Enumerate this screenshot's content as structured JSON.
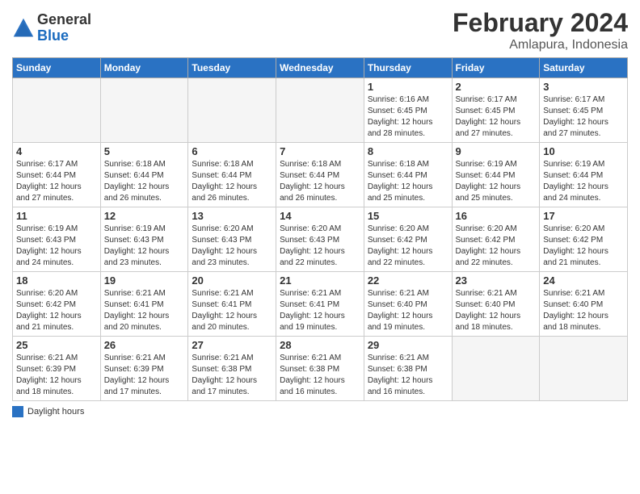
{
  "header": {
    "logo": {
      "general": "General",
      "blue": "Blue"
    },
    "title": "February 2024",
    "location": "Amlapura, Indonesia"
  },
  "days_of_week": [
    "Sunday",
    "Monday",
    "Tuesday",
    "Wednesday",
    "Thursday",
    "Friday",
    "Saturday"
  ],
  "weeks": [
    [
      {
        "day": "",
        "info": ""
      },
      {
        "day": "",
        "info": ""
      },
      {
        "day": "",
        "info": ""
      },
      {
        "day": "",
        "info": ""
      },
      {
        "day": "1",
        "info": "Sunrise: 6:16 AM\nSunset: 6:45 PM\nDaylight: 12 hours\nand 28 minutes."
      },
      {
        "day": "2",
        "info": "Sunrise: 6:17 AM\nSunset: 6:45 PM\nDaylight: 12 hours\nand 27 minutes."
      },
      {
        "day": "3",
        "info": "Sunrise: 6:17 AM\nSunset: 6:45 PM\nDaylight: 12 hours\nand 27 minutes."
      }
    ],
    [
      {
        "day": "4",
        "info": "Sunrise: 6:17 AM\nSunset: 6:44 PM\nDaylight: 12 hours\nand 27 minutes."
      },
      {
        "day": "5",
        "info": "Sunrise: 6:18 AM\nSunset: 6:44 PM\nDaylight: 12 hours\nand 26 minutes."
      },
      {
        "day": "6",
        "info": "Sunrise: 6:18 AM\nSunset: 6:44 PM\nDaylight: 12 hours\nand 26 minutes."
      },
      {
        "day": "7",
        "info": "Sunrise: 6:18 AM\nSunset: 6:44 PM\nDaylight: 12 hours\nand 26 minutes."
      },
      {
        "day": "8",
        "info": "Sunrise: 6:18 AM\nSunset: 6:44 PM\nDaylight: 12 hours\nand 25 minutes."
      },
      {
        "day": "9",
        "info": "Sunrise: 6:19 AM\nSunset: 6:44 PM\nDaylight: 12 hours\nand 25 minutes."
      },
      {
        "day": "10",
        "info": "Sunrise: 6:19 AM\nSunset: 6:44 PM\nDaylight: 12 hours\nand 24 minutes."
      }
    ],
    [
      {
        "day": "11",
        "info": "Sunrise: 6:19 AM\nSunset: 6:43 PM\nDaylight: 12 hours\nand 24 minutes."
      },
      {
        "day": "12",
        "info": "Sunrise: 6:19 AM\nSunset: 6:43 PM\nDaylight: 12 hours\nand 23 minutes."
      },
      {
        "day": "13",
        "info": "Sunrise: 6:20 AM\nSunset: 6:43 PM\nDaylight: 12 hours\nand 23 minutes."
      },
      {
        "day": "14",
        "info": "Sunrise: 6:20 AM\nSunset: 6:43 PM\nDaylight: 12 hours\nand 22 minutes."
      },
      {
        "day": "15",
        "info": "Sunrise: 6:20 AM\nSunset: 6:42 PM\nDaylight: 12 hours\nand 22 minutes."
      },
      {
        "day": "16",
        "info": "Sunrise: 6:20 AM\nSunset: 6:42 PM\nDaylight: 12 hours\nand 22 minutes."
      },
      {
        "day": "17",
        "info": "Sunrise: 6:20 AM\nSunset: 6:42 PM\nDaylight: 12 hours\nand 21 minutes."
      }
    ],
    [
      {
        "day": "18",
        "info": "Sunrise: 6:20 AM\nSunset: 6:42 PM\nDaylight: 12 hours\nand 21 minutes."
      },
      {
        "day": "19",
        "info": "Sunrise: 6:21 AM\nSunset: 6:41 PM\nDaylight: 12 hours\nand 20 minutes."
      },
      {
        "day": "20",
        "info": "Sunrise: 6:21 AM\nSunset: 6:41 PM\nDaylight: 12 hours\nand 20 minutes."
      },
      {
        "day": "21",
        "info": "Sunrise: 6:21 AM\nSunset: 6:41 PM\nDaylight: 12 hours\nand 19 minutes."
      },
      {
        "day": "22",
        "info": "Sunrise: 6:21 AM\nSunset: 6:40 PM\nDaylight: 12 hours\nand 19 minutes."
      },
      {
        "day": "23",
        "info": "Sunrise: 6:21 AM\nSunset: 6:40 PM\nDaylight: 12 hours\nand 18 minutes."
      },
      {
        "day": "24",
        "info": "Sunrise: 6:21 AM\nSunset: 6:40 PM\nDaylight: 12 hours\nand 18 minutes."
      }
    ],
    [
      {
        "day": "25",
        "info": "Sunrise: 6:21 AM\nSunset: 6:39 PM\nDaylight: 12 hours\nand 18 minutes."
      },
      {
        "day": "26",
        "info": "Sunrise: 6:21 AM\nSunset: 6:39 PM\nDaylight: 12 hours\nand 17 minutes."
      },
      {
        "day": "27",
        "info": "Sunrise: 6:21 AM\nSunset: 6:38 PM\nDaylight: 12 hours\nand 17 minutes."
      },
      {
        "day": "28",
        "info": "Sunrise: 6:21 AM\nSunset: 6:38 PM\nDaylight: 12 hours\nand 16 minutes."
      },
      {
        "day": "29",
        "info": "Sunrise: 6:21 AM\nSunset: 6:38 PM\nDaylight: 12 hours\nand 16 minutes."
      },
      {
        "day": "",
        "info": ""
      },
      {
        "day": "",
        "info": ""
      }
    ]
  ],
  "legend": {
    "box_color": "#2a72c3",
    "label": "Daylight hours"
  }
}
